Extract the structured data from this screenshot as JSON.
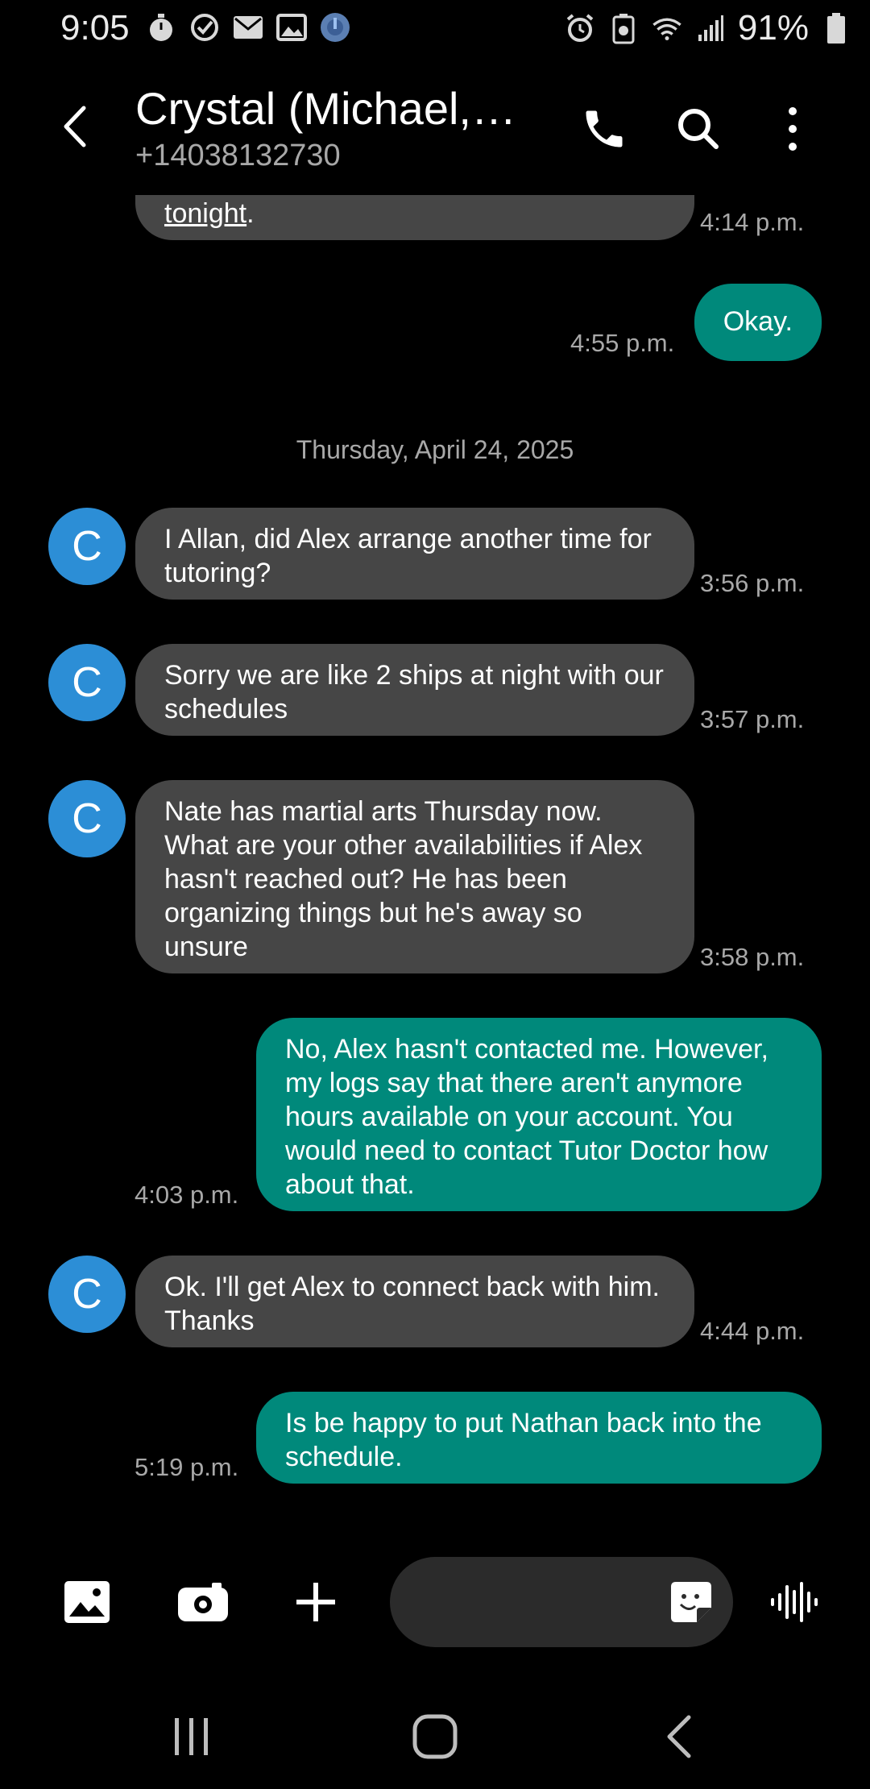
{
  "status_bar": {
    "time": "9:05",
    "battery": "91%",
    "left_icons": [
      "timer-icon",
      "check-circle-icon",
      "mail-icon",
      "image-icon",
      "globe-icon"
    ],
    "right_icons": [
      "alarm-icon",
      "battery-saver-icon",
      "wifi-icon",
      "signal-icon",
      "battery-icon"
    ]
  },
  "header": {
    "contact_name": "Crystal (Michael,…",
    "contact_number": "+14038132730"
  },
  "messages": [
    {
      "id": 0,
      "direction": "in",
      "text_plain": "",
      "link_text": "tonight",
      "trailing": ".",
      "time": "4:14 p.m."
    },
    {
      "id": 1,
      "direction": "out",
      "text": "Okay.",
      "time": "4:55 p.m."
    },
    {
      "id": 2,
      "direction": "in",
      "avatar": "C",
      "text": "I Allan, did Alex arrange another time for tutoring?",
      "time": "3:56 p.m."
    },
    {
      "id": 3,
      "direction": "in",
      "avatar": "C",
      "text": "Sorry we are like 2 ships at night with our schedules",
      "time": "3:57 p.m."
    },
    {
      "id": 4,
      "direction": "in",
      "avatar": "C",
      "text": "Nate has martial arts Thursday now. What are your other availabilities if Alex hasn't reached out? He has been organizing things but he's away so unsure",
      "time": "3:58 p.m."
    },
    {
      "id": 5,
      "direction": "out",
      "text": "No, Alex hasn't contacted me. However, my logs say that there aren't anymore hours available on your account. You would need to contact Tutor Doctor how about that.",
      "time": "4:03 p.m."
    },
    {
      "id": 6,
      "direction": "in",
      "avatar": "C",
      "text": "Ok. I'll get Alex to connect back with him. Thanks",
      "time": "4:44 p.m."
    },
    {
      "id": 7,
      "direction": "out",
      "text": "Is be happy to put Nathan back into the schedule.",
      "time": "5:19 p.m."
    }
  ],
  "date_separator": "Thursday, April 24, 2025",
  "composer": {
    "placeholder": "",
    "buttons": [
      "gallery-icon",
      "camera-icon",
      "plus-icon",
      "sticker-icon",
      "voice-icon"
    ]
  },
  "colors": {
    "incoming_bubble": "#464646",
    "outgoing_bubble": "#00897b",
    "avatar": "#2c8ed6"
  }
}
